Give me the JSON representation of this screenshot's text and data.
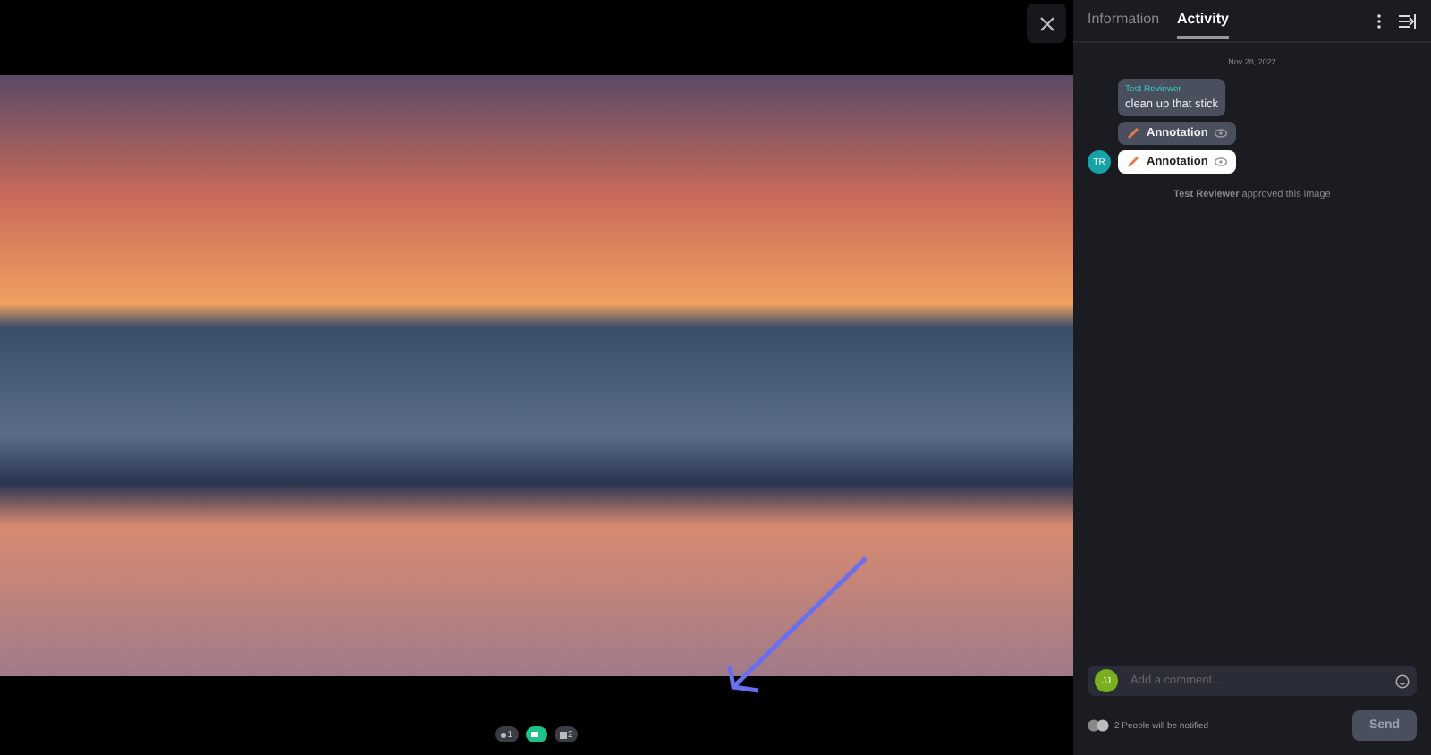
{
  "tabs": [
    {
      "label": "Information",
      "selected": false
    },
    {
      "label": "Activity",
      "selected": true
    }
  ],
  "activity": {
    "date": "Nov 28, 2022",
    "avatar": "TR",
    "comment": {
      "author": "Test Reviewer",
      "text": "clean up that stick"
    },
    "annotations": [
      {
        "label": "Annotation",
        "selected": false
      },
      {
        "label": "Annotation",
        "selected": true
      }
    ],
    "event": {
      "actor": "Test Reviewer",
      "text": "approved this image"
    }
  },
  "viewer_pills": [
    {
      "kind": "count",
      "text": "1",
      "selected": false
    },
    {
      "kind": "comment",
      "selected": true
    },
    {
      "kind": "image",
      "text": "2",
      "selected": false
    }
  ],
  "composer": {
    "avatar": "JJ",
    "placeholder": "Add a comment...",
    "notify": "2 People will be notified",
    "send": "Send"
  }
}
